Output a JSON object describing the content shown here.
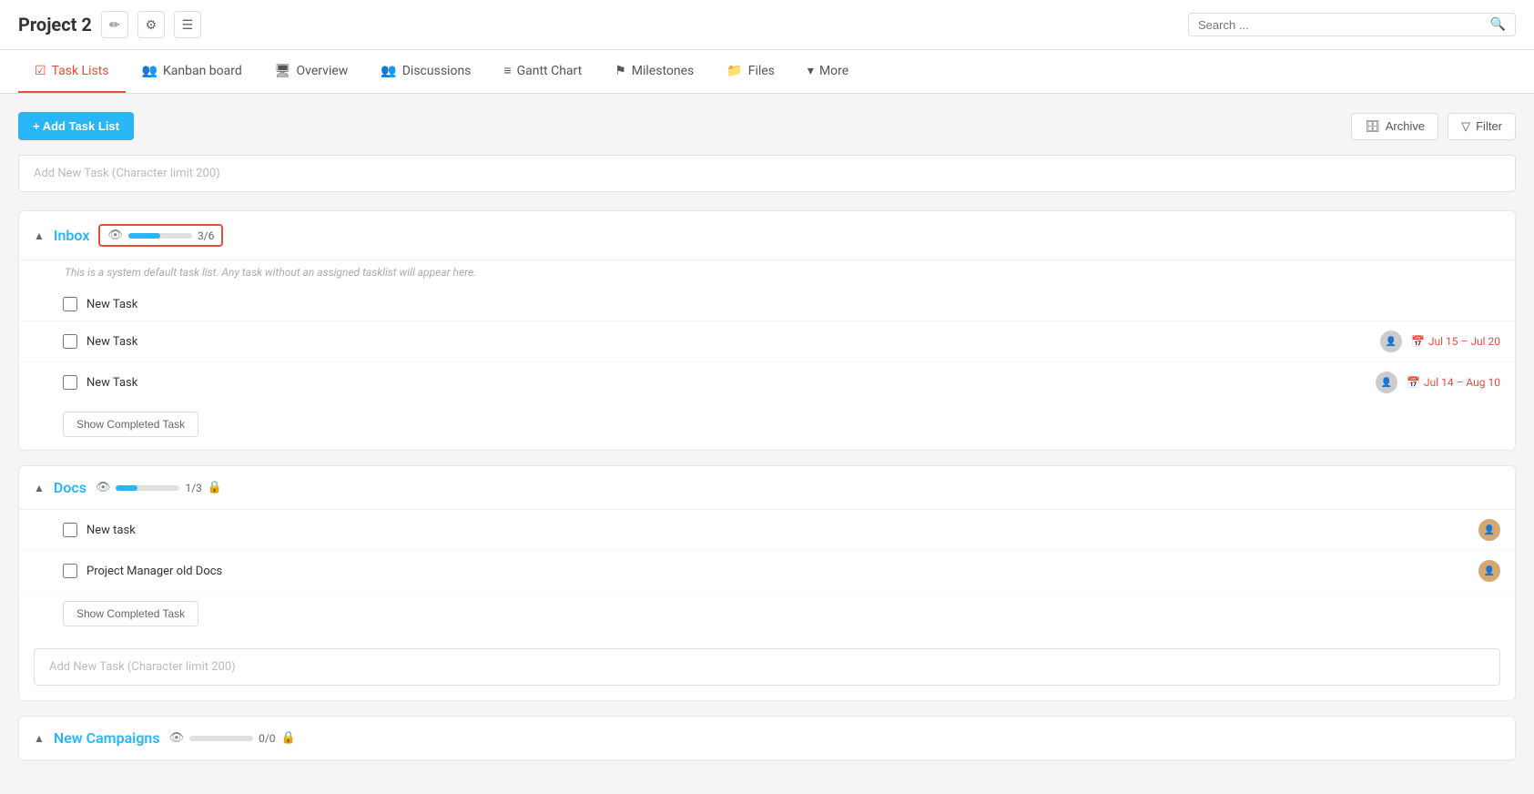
{
  "header": {
    "project_title": "Project 2",
    "edit_icon": "✏",
    "settings_icon": "⚙",
    "notes_icon": "☰",
    "search_placeholder": "Search ..."
  },
  "nav": {
    "tabs": [
      {
        "id": "task-lists",
        "label": "Task Lists",
        "icon": "☑",
        "active": true
      },
      {
        "id": "kanban",
        "label": "Kanban board",
        "icon": "👥",
        "active": false
      },
      {
        "id": "overview",
        "label": "Overview",
        "icon": "🖥",
        "active": false
      },
      {
        "id": "discussions",
        "label": "Discussions",
        "icon": "👥",
        "active": false
      },
      {
        "id": "gantt",
        "label": "Gantt Chart",
        "icon": "≡",
        "active": false
      },
      {
        "id": "milestones",
        "label": "Milestones",
        "icon": "⚑",
        "active": false
      },
      {
        "id": "files",
        "label": "Files",
        "icon": "📁",
        "active": false
      },
      {
        "id": "more",
        "label": "More",
        "icon": "▾",
        "active": false
      }
    ]
  },
  "toolbar": {
    "add_list_label": "+ Add Task List",
    "archive_label": "Archive",
    "filter_label": "Filter"
  },
  "add_new_task_top_placeholder": "Add New Task (Character limit 200)",
  "sections": [
    {
      "id": "inbox",
      "title": "Inbox",
      "progress_value": 50,
      "progress_label": "3/6",
      "has_border": true,
      "description": "This is a system default task list. Any task without an assigned tasklist will appear here.",
      "tasks": [
        {
          "id": 1,
          "name": "New Task",
          "has_avatar": false,
          "has_date": false
        },
        {
          "id": 2,
          "name": "New Task",
          "has_avatar": true,
          "has_date": true,
          "date": "Jul 15 – Jul 20"
        },
        {
          "id": 3,
          "name": "New Task",
          "has_avatar": true,
          "has_date": true,
          "date": "Jul 14 – Aug 10"
        }
      ],
      "show_completed_label": "Show Completed Task",
      "has_lock": false
    },
    {
      "id": "docs",
      "title": "Docs",
      "progress_value": 33,
      "progress_label": "1/3",
      "has_border": false,
      "description": "",
      "tasks": [
        {
          "id": 4,
          "name": "New task",
          "has_avatar": true,
          "has_date": false
        },
        {
          "id": 5,
          "name": "Project Manager old Docs",
          "has_avatar": true,
          "has_date": false
        }
      ],
      "show_completed_label": "Show Completed Task",
      "has_lock": true,
      "add_new_task_bottom_placeholder": "Add New Task (Character limit 200)"
    },
    {
      "id": "new-campaigns",
      "title": "New Campaigns",
      "progress_value": 0,
      "progress_label": "0/0",
      "has_border": false,
      "description": "",
      "tasks": [],
      "show_completed_label": "",
      "has_lock": true,
      "partial": true
    }
  ]
}
